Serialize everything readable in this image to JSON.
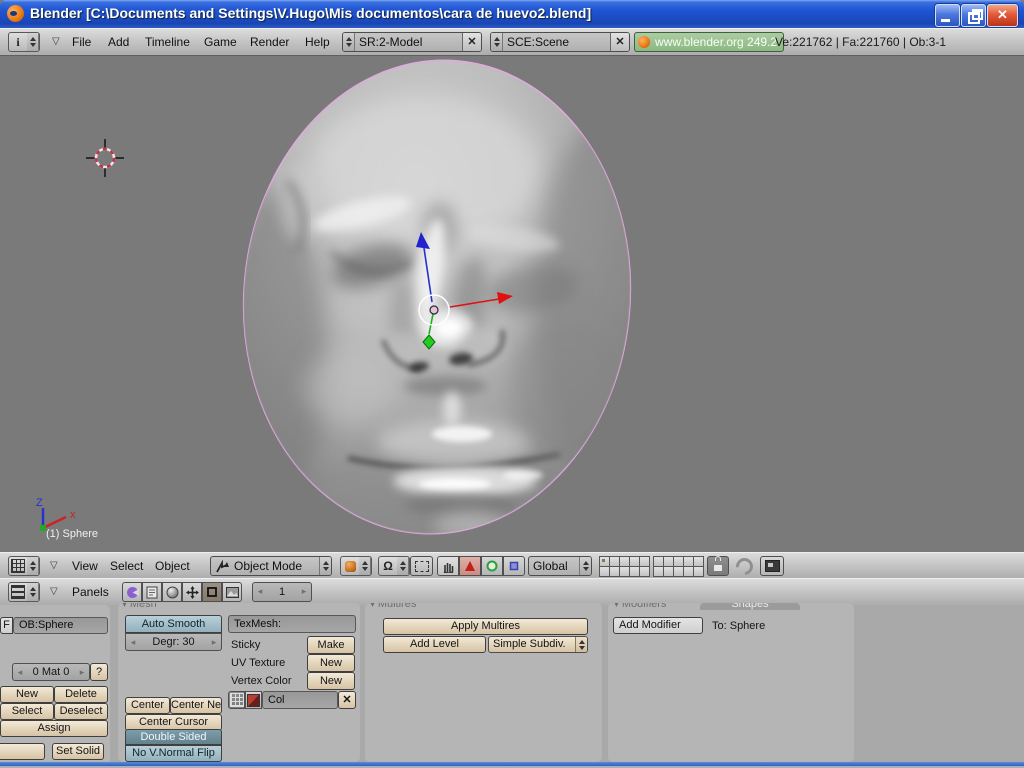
{
  "window": {
    "title": "Blender [C:\\Documents and Settings\\V.Hugo\\Mis documentos\\cara de huevo2.blend]"
  },
  "topbar": {
    "menus": [
      "File",
      "Add",
      "Timeline",
      "Game",
      "Render",
      "Help"
    ],
    "screen_combo": "SR:2-Model",
    "scene_combo": "SCE:Scene",
    "site_button": "www.blender.org 249.2",
    "stats": "Ve:221762 | Fa:221760 | Ob:3-1"
  },
  "viewport": {
    "object_label": "(1) Sphere",
    "axis_z": "Z",
    "axis_x": "x"
  },
  "view_header": {
    "menus": [
      "View",
      "Select",
      "Object"
    ],
    "mode": "Object Mode",
    "orientation": "Global"
  },
  "buttons_header": {
    "panels_label": "Panels",
    "frame": "1"
  },
  "panels": {
    "link": {
      "f": "F",
      "ob": "OB:Sphere",
      "mat": "0 Mat 0",
      "help": "?",
      "new": "New",
      "del": "Delete",
      "select": "Select",
      "deselect": "Deselect",
      "assign": "Assign",
      "set_solid": "Set Solid"
    },
    "mesh": {
      "header": "Mesh",
      "auto_smooth": "Auto Smooth",
      "degr": "Degr: 30",
      "texmesh": "TexMesh:",
      "sticky": "Sticky",
      "make": "Make",
      "uv": "UV Texture",
      "new_uv": "New",
      "vcol": "Vertex Color",
      "new_vcol": "New",
      "col": "Col",
      "center": "Center",
      "center_new": "Center New",
      "center_cursor": "Center Cursor",
      "double_sided": "Double Sided",
      "no_vnormal": "No V.Normal Flip"
    },
    "multires": {
      "header": "Multires",
      "apply": "Apply Multires",
      "add_level": "Add Level",
      "subdiv": "Simple Subdiv."
    },
    "modifiers": {
      "tab_modifiers": "Modifiers",
      "tab_shapes": "Shapes",
      "add_modifier": "Add Modifier",
      "to": "To: Sphere"
    }
  },
  "icons": {
    "close": "✕",
    "collapse": "▽",
    "left": "◂",
    "right": "▸",
    "pivot": "Ω",
    "info": "i"
  },
  "colors": {
    "selection_outline": "#dfaade",
    "axis_x": "#cc2222",
    "axis_y": "#22aa22",
    "axis_z": "#2233cc",
    "site_green": "#8db784",
    "titlebar_blue": "#2055d4",
    "viewport_gray": "#7a7a7a"
  }
}
